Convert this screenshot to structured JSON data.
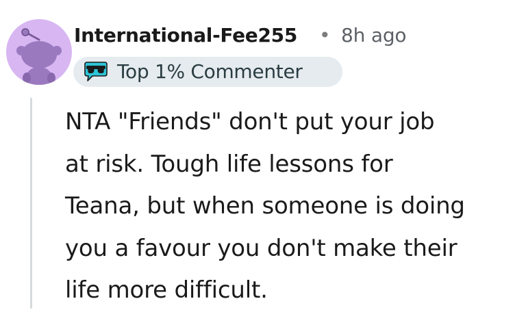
{
  "comment": {
    "author": "International-Fee255",
    "separator": "•",
    "timestamp": "8h ago",
    "flair": {
      "icon": "sunglasses-speech-bubble-icon",
      "label": "Top 1% Commenter"
    },
    "body_lines": [
      "NTA \"Friends\" don't put your job",
      "at risk. Tough life lessons for",
      "Teana, but when someone is doing",
      "you a favour you don't make their",
      "life more difficult."
    ],
    "avatar": {
      "icon": "snoo-avatar-icon",
      "background_color": "#d7b6f2"
    }
  }
}
